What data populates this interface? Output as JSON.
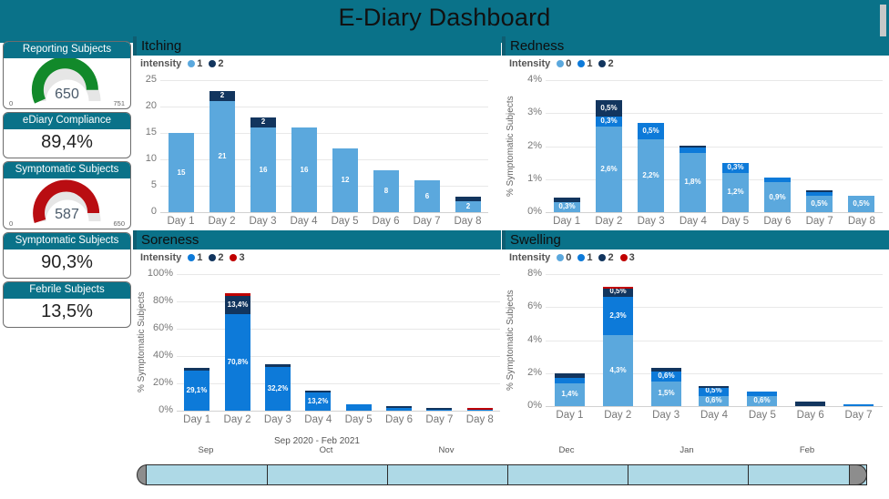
{
  "header": {
    "title": "E-Diary Dashboard",
    "bg_color": "#0a7289",
    "scrollbar": "vertical-scrollbar-thumb"
  },
  "kpi_cards": [
    {
      "id": "reporting-subjects",
      "title": "Reporting Subjects",
      "type": "gauge",
      "value": "650",
      "min": "0",
      "max": "751",
      "value_num": 650,
      "max_num": 751,
      "arc_color": "#12892a"
    },
    {
      "id": "ediary-compliance",
      "title": "eDiary Compliance",
      "type": "value",
      "value": "89,4%"
    },
    {
      "id": "symptomatic-subjects-gauge",
      "title": "Symptomatic Subjects",
      "type": "gauge",
      "value": "587",
      "min": "0",
      "max": "650",
      "value_num": 587,
      "max_num": 650,
      "arc_color": "#b90d12"
    },
    {
      "id": "symptomatic-subjects-pct",
      "title": "Symptomatic Subjects",
      "type": "value",
      "value": "90,3%"
    },
    {
      "id": "febrile-subjects",
      "title": "Febrile Subjects",
      "type": "value",
      "value": "13,5%"
    }
  ],
  "colors": {
    "teal": "#0a7289",
    "light_blue": "#5ba8dd",
    "blue": "#0d7ad9",
    "navy": "#12355e",
    "red": "#c00000",
    "green": "#12892a",
    "dark_red": "#b90d12"
  },
  "chart_data": [
    {
      "id": "itching",
      "type": "bar",
      "stacked": true,
      "title": "Itching",
      "legend_title": "intensity",
      "legend": [
        {
          "label": "1",
          "color": "#5ba8dd"
        },
        {
          "label": "2",
          "color": "#12355e"
        }
      ],
      "categories": [
        "Day 1",
        "Day 2",
        "Day 3",
        "Day 4",
        "Day 5",
        "Day 6",
        "Day 7",
        "Day 8"
      ],
      "series": [
        {
          "name": "1",
          "color": "#5ba8dd",
          "values": [
            15,
            21,
            16,
            16,
            12,
            8,
            6,
            2
          ],
          "labels": [
            "15",
            "21",
            "16",
            "16",
            "12",
            "8",
            "6",
            "2"
          ]
        },
        {
          "name": "2",
          "color": "#12355e",
          "values": [
            0,
            2,
            2,
            0,
            0,
            0,
            0,
            1
          ],
          "labels": [
            "",
            "2",
            "2",
            "",
            "",
            "",
            "",
            ""
          ]
        }
      ],
      "ylabel": "",
      "yticks": [
        "0",
        "5",
        "10",
        "15",
        "20",
        "25"
      ],
      "ylim": [
        0,
        25
      ],
      "grid": true
    },
    {
      "id": "redness",
      "type": "bar",
      "stacked": true,
      "title": "Redness",
      "legend_title": "Intensity",
      "legend": [
        {
          "label": "0",
          "color": "#5ba8dd"
        },
        {
          "label": "1",
          "color": "#0d7ad9"
        },
        {
          "label": "2",
          "color": "#12355e"
        }
      ],
      "categories": [
        "Day 1",
        "Day 2",
        "Day 3",
        "Day 4",
        "Day 5",
        "Day 6",
        "Day 7",
        "Day 8"
      ],
      "series": [
        {
          "name": "0",
          "color": "#5ba8dd",
          "values": [
            0.3,
            2.6,
            2.2,
            1.8,
            1.2,
            0.9,
            0.5,
            0.5
          ],
          "labels": [
            "0,3%",
            "2,6%",
            "2,2%",
            "1,8%",
            "1,2%",
            "0,9%",
            "0,5%",
            "0,5%"
          ]
        },
        {
          "name": "1",
          "color": "#0d7ad9",
          "values": [
            0.0,
            0.3,
            0.5,
            0.15,
            0.3,
            0.15,
            0.1,
            0.0
          ],
          "labels": [
            "",
            "0,3%",
            "0,5%",
            "",
            "0,3%",
            "",
            "",
            ""
          ]
        },
        {
          "name": "2",
          "color": "#12355e",
          "values": [
            0.15,
            0.5,
            0.0,
            0.05,
            0.0,
            0.0,
            0.05,
            0.0
          ],
          "labels": [
            "",
            "0,5%",
            "",
            "",
            "",
            "",
            "",
            ""
          ]
        }
      ],
      "ylabel": "% Symptomatic Subjects",
      "yticks": [
        "0%",
        "1%",
        "2%",
        "3%",
        "4%"
      ],
      "ylim": [
        0,
        4
      ],
      "grid": true
    },
    {
      "id": "soreness",
      "type": "bar",
      "stacked": true,
      "title": "Soreness",
      "legend_title": "Intensity",
      "legend": [
        {
          "label": "1",
          "color": "#0d7ad9"
        },
        {
          "label": "2",
          "color": "#12355e"
        },
        {
          "label": "3",
          "color": "#c00000"
        }
      ],
      "categories": [
        "Day 1",
        "Day 2",
        "Day 3",
        "Day 4",
        "Day 5",
        "Day 6",
        "Day 7",
        "Day 8"
      ],
      "series": [
        {
          "name": "1",
          "color": "#0d7ad9",
          "values": [
            29.1,
            70.8,
            32.2,
            13.2,
            5.0,
            1.8,
            1.0,
            0.7
          ],
          "labels": [
            "29,1%",
            "70,8%",
            "32,2%",
            "13,2%",
            "",
            "",
            "",
            ""
          ]
        },
        {
          "name": "2",
          "color": "#12355e",
          "values": [
            2.3,
            13.4,
            1.6,
            1.4,
            0.0,
            0.4,
            0.3,
            0.0
          ],
          "labels": [
            "",
            "13,4%",
            "",
            "",
            "",
            "",
            "",
            ""
          ]
        },
        {
          "name": "3",
          "color": "#c00000",
          "values": [
            0.0,
            1.6,
            0.0,
            0.0,
            0.0,
            0.0,
            0.0,
            0.5
          ],
          "labels": [
            "",
            "",
            "",
            "",
            "",
            "",
            "",
            ""
          ]
        }
      ],
      "ylabel": "% Symptomatic Subjects",
      "yticks": [
        "0%",
        "20%",
        "40%",
        "60%",
        "80%",
        "100%"
      ],
      "ylim": [
        0,
        100
      ],
      "xaxis_caption": "Sep 2020 - Feb 2021",
      "grid": true
    },
    {
      "id": "swelling",
      "type": "bar",
      "stacked": true,
      "title": "Swelling",
      "legend_title": "Intensity",
      "legend": [
        {
          "label": "0",
          "color": "#5ba8dd"
        },
        {
          "label": "1",
          "color": "#0d7ad9"
        },
        {
          "label": "2",
          "color": "#12355e"
        },
        {
          "label": "3",
          "color": "#c00000"
        }
      ],
      "categories": [
        "Day 1",
        "Day 2",
        "Day 3",
        "Day 4",
        "Day 5",
        "Day 6",
        "Day 7"
      ],
      "series": [
        {
          "name": "0",
          "color": "#5ba8dd",
          "values": [
            1.4,
            4.3,
            1.5,
            0.6,
            0.6,
            0.0,
            0.0
          ],
          "labels": [
            "1,4%",
            "4,3%",
            "1,5%",
            "0,6%",
            "0,6%",
            "",
            ""
          ]
        },
        {
          "name": "1",
          "color": "#0d7ad9",
          "values": [
            0.3,
            2.3,
            0.6,
            0.5,
            0.3,
            0.0,
            0.12
          ],
          "labels": [
            "",
            "2,3%",
            "0,6%",
            "0,5%",
            "",
            "",
            ""
          ]
        },
        {
          "name": "2",
          "color": "#12355e",
          "values": [
            0.3,
            0.5,
            0.2,
            0.1,
            0.0,
            0.25,
            0.0
          ],
          "labels": [
            "",
            "0,5%",
            "",
            "",
            "",
            "",
            ""
          ]
        },
        {
          "name": "3",
          "color": "#c00000",
          "values": [
            0.0,
            0.15,
            0.0,
            0.0,
            0.0,
            0.0,
            0.0
          ],
          "labels": [
            "",
            "",
            "",
            "",
            "",
            "",
            ""
          ]
        }
      ],
      "ylabel": "% Symptomatic Subjects",
      "yticks": [
        "0%",
        "2%",
        "4%",
        "6%",
        "8%"
      ],
      "ylim": [
        0,
        8
      ],
      "grid": true
    }
  ],
  "timeline": {
    "name": "date-range-slider",
    "ticks": [
      "Sep",
      "Oct",
      "Nov",
      "Dec",
      "Jan",
      "Feb"
    ],
    "selected_range": "Sep 2020 - Feb 2021"
  }
}
